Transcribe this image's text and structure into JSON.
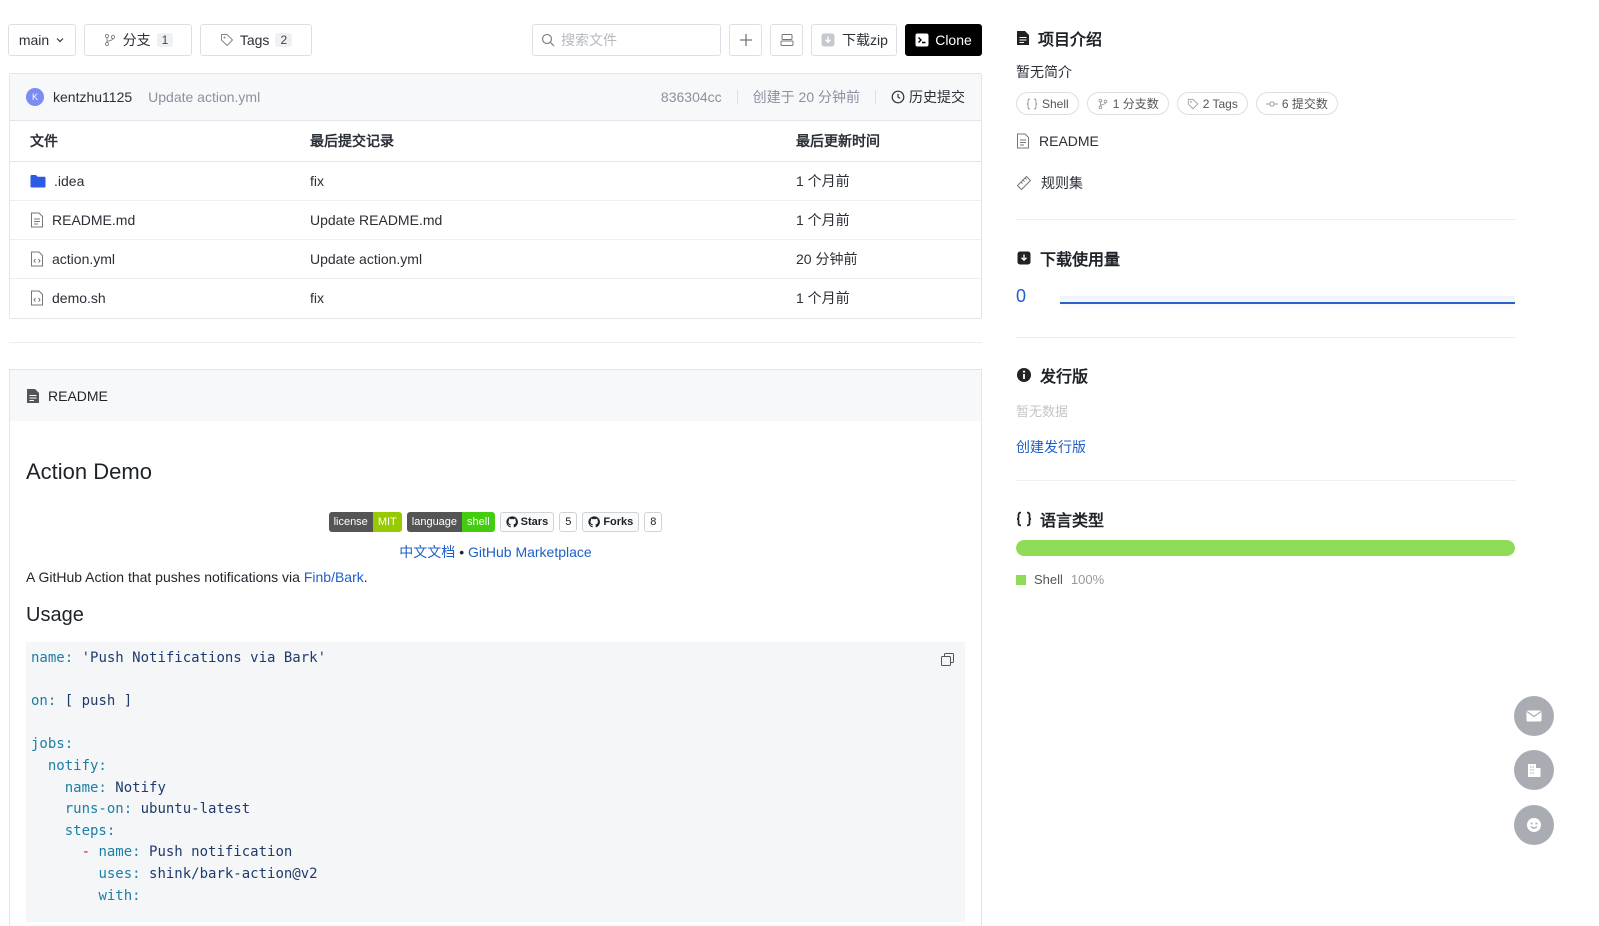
{
  "toolbar": {
    "branch": "main",
    "branches_label": "分支",
    "branches_count": "1",
    "tags_label": "Tags",
    "tags_count": "2",
    "search_placeholder": "搜索文件",
    "download_label": "下载zip",
    "clone_label": "Clone"
  },
  "commit": {
    "avatar": "K",
    "user": "kentzhu1125",
    "message": "Update action.yml",
    "hash": "836304cc",
    "created": "创建于 20 分钟前",
    "history_label": "历史提交"
  },
  "files": {
    "headers": [
      "文件",
      "最后提交记录",
      "最后更新时间"
    ],
    "rows": [
      {
        "name": ".idea",
        "type": "folder",
        "commit": "fix",
        "time": "1 个月前"
      },
      {
        "name": "README.md",
        "type": "file",
        "commit": "Update README.md",
        "time": "1 个月前"
      },
      {
        "name": "action.yml",
        "type": "code",
        "commit": "Update action.yml",
        "time": "20 分钟前"
      },
      {
        "name": "demo.sh",
        "type": "code",
        "commit": "fix",
        "time": "1 个月前"
      }
    ]
  },
  "readme": {
    "header": "README",
    "title": "Action Demo",
    "badges": {
      "license_key": "license",
      "license_val": "MIT",
      "language_key": "language",
      "language_val": "shell",
      "stars_label": "Stars",
      "stars_count": "5",
      "forks_label": "Forks",
      "forks_count": "8"
    },
    "link_cn": "中文文档",
    "link_sep": "•",
    "link_market": "GitHub Marketplace",
    "desc_prefix": "A GitHub Action that pushes notifications via ",
    "desc_link": "Finb/Bark",
    "desc_suffix": ".",
    "usage_title": "Usage",
    "code_lines": [
      {
        "indent": 0,
        "key": "name:",
        "val": " 'Push Notifications via Bark'"
      },
      {
        "indent": 0,
        "key": "",
        "val": ""
      },
      {
        "indent": 0,
        "key": "on:",
        "val": " [ push ]"
      },
      {
        "indent": 0,
        "key": "",
        "val": ""
      },
      {
        "indent": 0,
        "key": "jobs:",
        "val": ""
      },
      {
        "indent": 2,
        "key": "notify:",
        "val": ""
      },
      {
        "indent": 4,
        "key": "name:",
        "val": " Notify"
      },
      {
        "indent": 4,
        "key": "runs-on:",
        "val": " ubuntu-latest"
      },
      {
        "indent": 4,
        "key": "steps:",
        "val": ""
      },
      {
        "indent": 6,
        "dash": "- ",
        "key": "name:",
        "val": " Push notification"
      },
      {
        "indent": 8,
        "key": "uses:",
        "val": " shink/bark-action@v2"
      },
      {
        "indent": 8,
        "key": "with:",
        "val": ""
      }
    ]
  },
  "sidebar": {
    "intro_title": "项目介绍",
    "intro_text": "暂无简介",
    "chips": [
      "Shell",
      "1 分支数",
      "2 Tags",
      "6 提交数"
    ],
    "readme_link": "README",
    "rules_link": "规则集",
    "downloads_title": "下载使用量",
    "downloads_count": "0",
    "release_title": "发行版",
    "release_empty": "暂无数据",
    "release_create": "创建发行版",
    "lang_title": "语言类型",
    "lang_name": "Shell",
    "lang_percent": "100%",
    "lang_fraction": 1.0,
    "lang_color": "#8fdc58"
  },
  "colors": {
    "accent": "#1f5fc6",
    "dark_button": "#000000"
  }
}
